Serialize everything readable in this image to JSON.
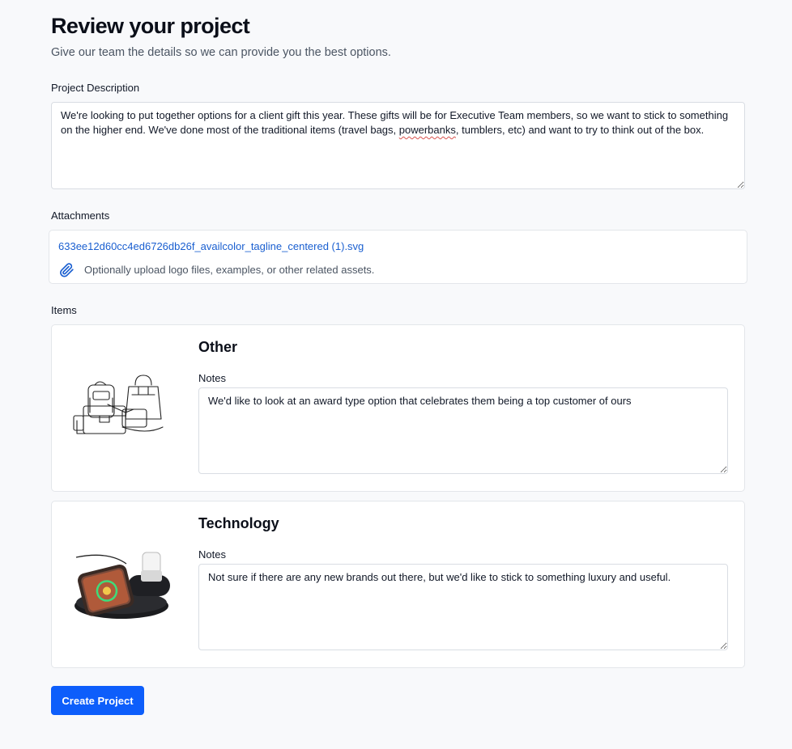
{
  "header": {
    "title": "Review your project",
    "subtitle": "Give our team the details so we can provide you the best options."
  },
  "description": {
    "label": "Project Description",
    "value_before": "We're looking to put together options for a client gift this year. These gifts will be for Executive Team members, so we want to stick to something on the higher end. We've done most of the traditional items (travel bags, ",
    "value_misspelled": "powerbanks",
    "value_after": ", tumblers, etc) and want to try to think out of the box."
  },
  "attachments": {
    "label": "Attachments",
    "file_name": "633ee12d60cc4ed6726db26f_availcolor_tagline_centered (1).svg",
    "hint": "Optionally upload logo files, examples, or other related assets.",
    "icon": "paperclip-icon"
  },
  "items": {
    "label": "Items",
    "list": [
      {
        "title": "Other",
        "notes_label": "Notes",
        "notes": "We'd like to look at an award type option that celebrates them being a top customer of ours",
        "image": "bags-line-drawing"
      },
      {
        "title": "Technology",
        "notes_label": "Notes",
        "notes": "Not sure if there are any new brands out there, but we'd like to stick to something luxury and useful.",
        "image": "wireless-charger-photo"
      }
    ]
  },
  "actions": {
    "create_label": "Create Project"
  },
  "colors": {
    "accent": "#0d5efb",
    "link": "#1a5fd0",
    "background": "#f8f9fb"
  }
}
